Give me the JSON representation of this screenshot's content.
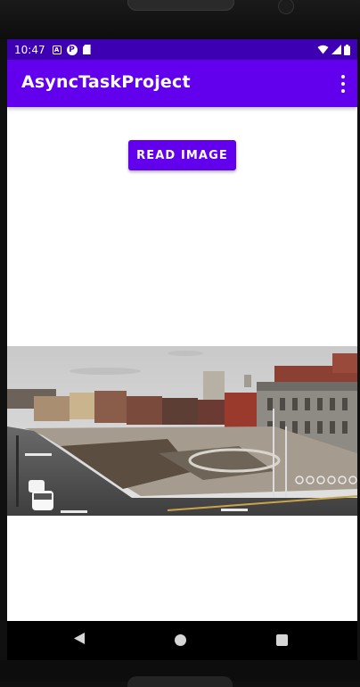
{
  "status_bar": {
    "time": "10:47",
    "icons": [
      "a-notification-icon",
      "p-notification-icon",
      "sd-card-icon",
      "wifi-icon",
      "signal-icon",
      "battery-icon"
    ]
  },
  "app_bar": {
    "title": "AsyncTaskProject",
    "menu_icon": "more-vert-icon",
    "color": "#6200ee",
    "status_color": "#3d00b3"
  },
  "main": {
    "read_button_label": "READ IMAGE",
    "image_icon": "city-photo"
  },
  "nav_bar": {
    "icons": [
      "back-icon",
      "home-icon",
      "recents-icon"
    ]
  }
}
